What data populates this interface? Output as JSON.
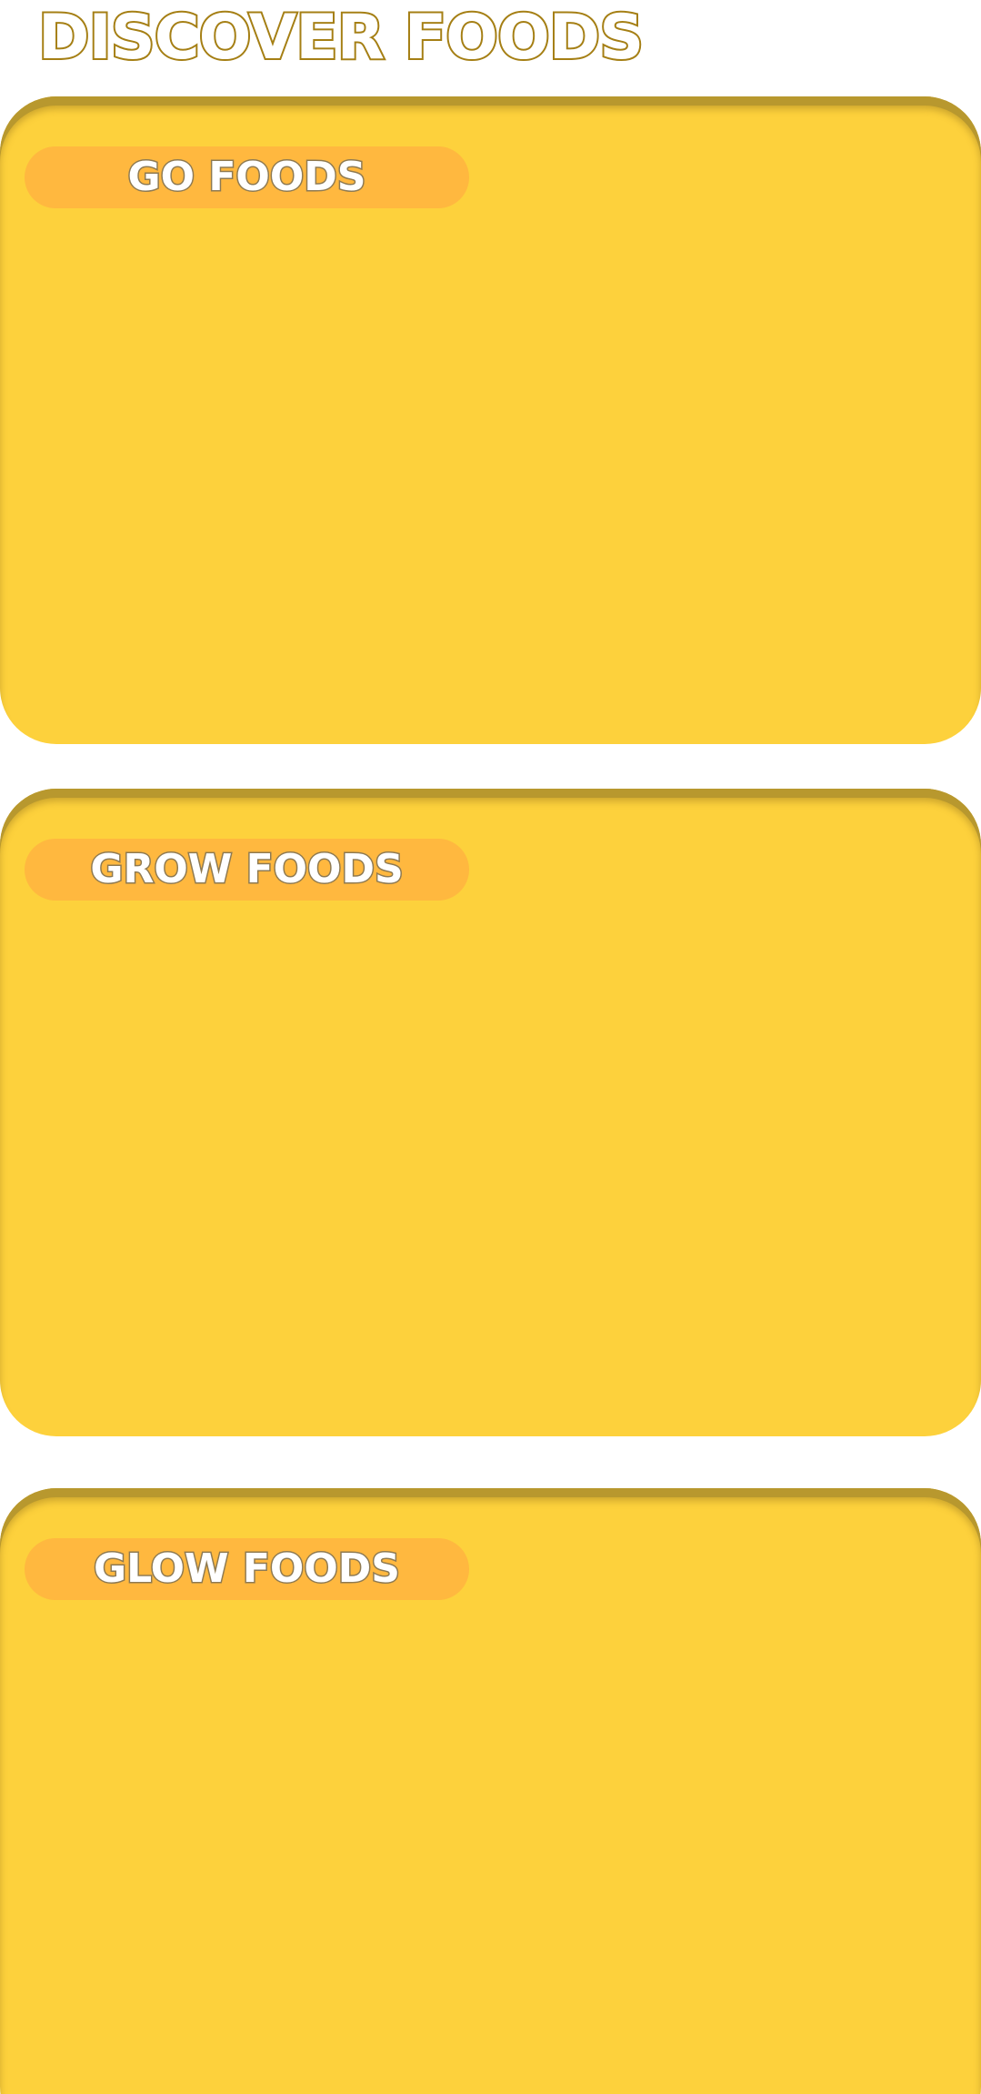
{
  "header": {
    "title": "DISCOVER FOODS"
  },
  "sections": [
    {
      "label": "GO FOODS"
    },
    {
      "label": "GROW FOODS"
    },
    {
      "label": "GLOW FOODS"
    }
  ],
  "colors": {
    "panel": "#fdd13c",
    "panel_rim": "#b8982e",
    "label_pill": "#ffb83f",
    "title_outline": "#a57f14",
    "label_outline": "#8e7a52",
    "background": "#ffffff"
  }
}
